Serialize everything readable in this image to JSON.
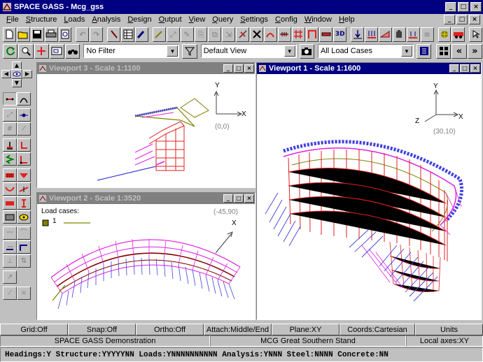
{
  "window": {
    "title": "SPACE GASS - Mcg_gss"
  },
  "menu": [
    "File",
    "Structure",
    "Loads",
    "Analysis",
    "Design",
    "Output",
    "View",
    "Query",
    "Settings",
    "Config",
    "Window",
    "Help"
  ],
  "toolbar2": {
    "filter": "No Filter",
    "view": "Default View",
    "load_cases": "All Load Cases"
  },
  "viewports": {
    "vp3": {
      "title": "Viewport 3 - Scale 1:1100",
      "axis_y": "Y",
      "axis_x": "X",
      "origin": "(0,0)"
    },
    "vp2": {
      "title": "Viewport 2 - Scale 1:3520",
      "load_cases_label": "Load cases:",
      "load_case_1": "1",
      "coord": "(-45,90)",
      "axis_x": "X"
    },
    "vp1": {
      "title": "Viewport 1 - Scale 1:1600",
      "axis_y": "Y",
      "axis_x": "X",
      "axis_z": "Z",
      "coord": "(30,10)"
    }
  },
  "status": {
    "grid": "Grid:Off",
    "snap": "Snap:Off",
    "ortho": "Ortho:Off",
    "attach": "Attach:Middle/End",
    "plane": "Plane:XY",
    "coords": "Coords:Cartesian",
    "units": "Units",
    "demo": "SPACE GASS Demonstration",
    "project": "MCG Great Southern Stand",
    "axes": "Local axes:XY",
    "headings": "Headings:Y Structure:YYYYYNN Loads:YNNNNNNNNNN Analysis:YNNN Steel:NNNN Concrete:NN"
  },
  "colors": {
    "titlebar": "#000080",
    "frame_red": "#e02020",
    "purlin_magenta": "#e020e0",
    "load_blue": "#4040e0",
    "roof_olive": "#808000",
    "background": "#c0c0c0"
  }
}
